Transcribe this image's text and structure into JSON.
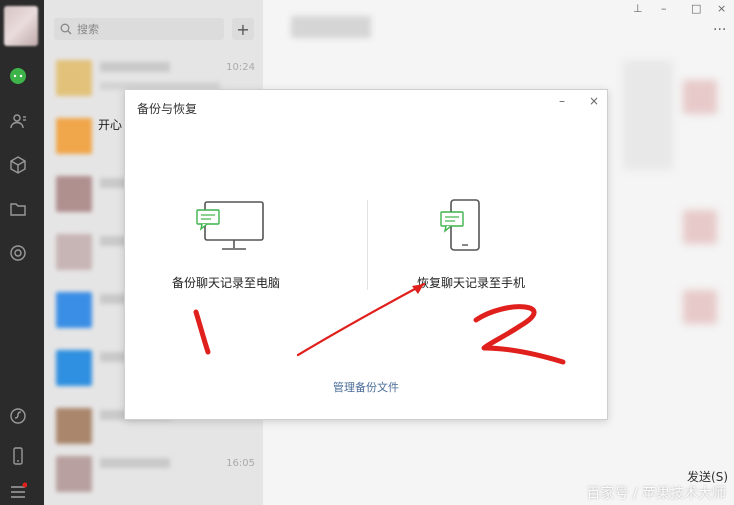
{
  "search": {
    "placeholder": "搜索",
    "plus_label": "+"
  },
  "chat_list": [
    {
      "time": "10:24",
      "name": ""
    },
    {
      "time": "",
      "name": "开心"
    },
    {
      "time": "16:05",
      "name": ""
    }
  ],
  "modal": {
    "title": "备份与恢复",
    "minimize_label": "–",
    "close_label": "×",
    "backup_label": "备份聊天记录至电脑",
    "restore_label": "恢复聊天记录至手机",
    "manage_link": "管理备份文件"
  },
  "chat": {
    "more_label": "···",
    "send_label": "发送(S)",
    "watermark": "百家号 / 苹果技术大师"
  },
  "annotations": {
    "one": "1",
    "two": "2"
  },
  "colors": {
    "annotation_red": "#e0201c",
    "accent_green": "#3db34a",
    "link_blue": "#4a6c98"
  }
}
